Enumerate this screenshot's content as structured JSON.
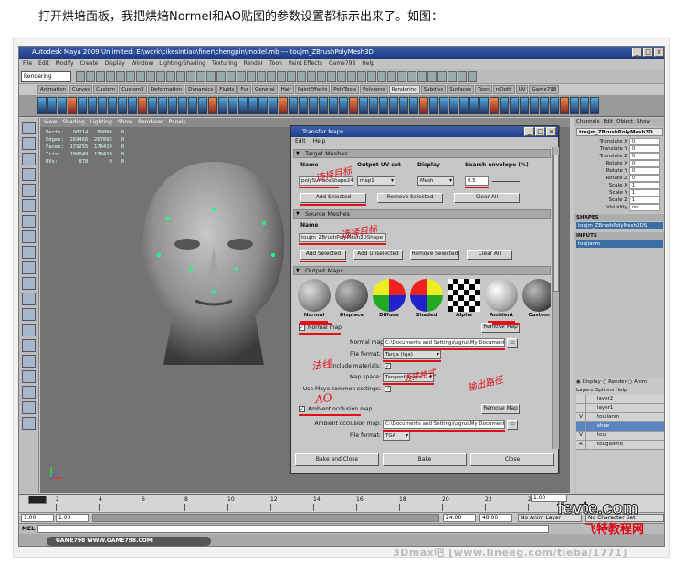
{
  "caption": "打开烘培面板，我把烘焙Normel和AO贴图的参数设置都标示出来了。如图：",
  "app": {
    "title": "Autodesk Maya 2009 Unlimited: E:\\work\\cikesintiao\\finer\\chengpin\\model.mb   ---   toujm_ZBrushPolyMesh3D",
    "menus": [
      "File",
      "Edit",
      "Modify",
      "Create",
      "Display",
      "Window",
      "Lighting/Shading",
      "Texturing",
      "Render",
      "Toon",
      "Paint Effects",
      "Game798",
      "Help"
    ],
    "mode": "Rendering",
    "shelf_tabs": [
      "Animation",
      "Curves",
      "Custom",
      "Custom2",
      "Deformation",
      "Dynamics",
      "Fluids",
      "Fur",
      "General",
      "Hair",
      "PaintEffects",
      "PolyTools",
      "Polygons",
      "Rendering",
      "Subdivs",
      "Surfaces",
      "Toon",
      "nCloth",
      "UV",
      "Game798"
    ],
    "active_shelf": "Rendering"
  },
  "viewport": {
    "menus": [
      "View",
      "Shading",
      "Lighting",
      "Show",
      "Renderer",
      "Panels"
    ],
    "hud": [
      [
        "Verts:",
        "90214",
        "89886",
        "0"
      ],
      [
        "Edges:",
        "269466",
        "267893",
        "0"
      ],
      [
        "Faces:",
        "179255",
        "178419",
        "0"
      ],
      [
        "Tris:",
        "180049",
        "178419",
        "0"
      ],
      [
        "UVs:",
        "878",
        "0",
        "0"
      ]
    ]
  },
  "channel_box": {
    "tabs": [
      "Channels",
      "Edit",
      "Object",
      "Show"
    ],
    "object": "toujm_ZBrushPolyMesh3D",
    "attributes": [
      {
        "name": "Translate X",
        "value": "0"
      },
      {
        "name": "Translate Y",
        "value": "0"
      },
      {
        "name": "Translate Z",
        "value": "0"
      },
      {
        "name": "Rotate X",
        "value": "0"
      },
      {
        "name": "Rotate Y",
        "value": "0"
      },
      {
        "name": "Rotate Z",
        "value": "0"
      },
      {
        "name": "Scale X",
        "value": "1"
      },
      {
        "name": "Scale Y",
        "value": "1"
      },
      {
        "name": "Scale Z",
        "value": "1"
      },
      {
        "name": "Visibility",
        "value": "on"
      }
    ],
    "shapes_label": "SHAPES",
    "shape_name": "toujm_ZBrushPolyMesh3DS",
    "inputs_label": "INPUTS",
    "input_name": "toujianm"
  },
  "layer_editor": {
    "display_modes": [
      "Display",
      "Render",
      "Anim"
    ],
    "menus": [
      "Layers",
      "Options",
      "Help"
    ],
    "layers": [
      {
        "name": "layer2",
        "v": "",
        "sel": false
      },
      {
        "name": "layer1",
        "v": "",
        "sel": false
      },
      {
        "name": "toujianm",
        "v": "V",
        "sel": false
      },
      {
        "name": "shoe",
        "v": "",
        "sel": true
      },
      {
        "name": "tou",
        "v": "V",
        "sel": false
      },
      {
        "name": "tougaomo",
        "v": "R",
        "sel": false
      }
    ]
  },
  "timeline": {
    "ticks": [
      "2",
      "4",
      "6",
      "8",
      "10",
      "12",
      "14",
      "16",
      "18",
      "20",
      "22",
      "24"
    ],
    "current": "1.00",
    "range_start": "1.00",
    "range_inner_start": "1.00",
    "range_inner_end": "24.00",
    "range_end": "48.00",
    "anim_layer": "No Anim Layer",
    "char_set": "No Character Set",
    "mel_label": "MEL"
  },
  "help_badge": "GAME798   WWW.GAME798.COM",
  "dialog": {
    "title": "Transfer Maps",
    "menus": [
      "Edit",
      "Help"
    ],
    "target": {
      "header": "Target Meshes",
      "col_name": "Name",
      "col_output_uv": "Output UV set",
      "col_display": "Display",
      "col_envelope": "Search envelope (%)",
      "mesh_name": "polySurfaceShape2417",
      "uv_set": "map1",
      "display": "Mesh",
      "envelope": "0.5",
      "btn_add": "Add Selected",
      "btn_remove": "Remove Selected",
      "btn_clear": "Clear All"
    },
    "source": {
      "header": "Source Meshes",
      "col_name": "Name",
      "mesh_name": "toujm_ZBrushPolyMesh3DShape",
      "btn_add": "Add Selected",
      "btn_add_unselected": "Add Unselected",
      "btn_remove": "Remove Selected",
      "btn_clear": "Clear All"
    },
    "output": {
      "header": "Output Maps",
      "maps": [
        "Normal",
        "Displace",
        "Diffuse",
        "Shaded",
        "Alpha",
        "Ambient",
        "Custom"
      ],
      "normal_check": "Normal map",
      "normal_remove": "Remove Map",
      "normal_map_label": "Normal map:",
      "normal_map_path": "C:\\Documents and Settings\\zgrui\\My Documents\\ma",
      "file_format_label": "File format:",
      "normal_format": "Targa (tga)",
      "include_materials": "Include materials:",
      "map_space_label": "Map space:",
      "map_space": "Tangent space",
      "use_maya_common": "Use Maya common settings:",
      "ao_check": "Ambient occlusion map",
      "ao_remove": "Remove Map",
      "ao_map_label": "Ambient occlusion map:",
      "ao_map_path": "C:\\Documents and Settings\\zgrui\\My Documents\\ma",
      "ao_format": "TGA"
    },
    "btn_bake_close": "Bake and Close",
    "btn_bake": "Bake",
    "btn_close": "Close"
  },
  "annotations": [
    "选择目标",
    "AO",
    "法线",
    "选择格式",
    "输出路径"
  ],
  "watermarks": {
    "site": "fevte.com",
    "site_cn": "飞特教程网",
    "bottom": "3Dmax吧 [www.lineeg.com/tieba/1771]"
  }
}
